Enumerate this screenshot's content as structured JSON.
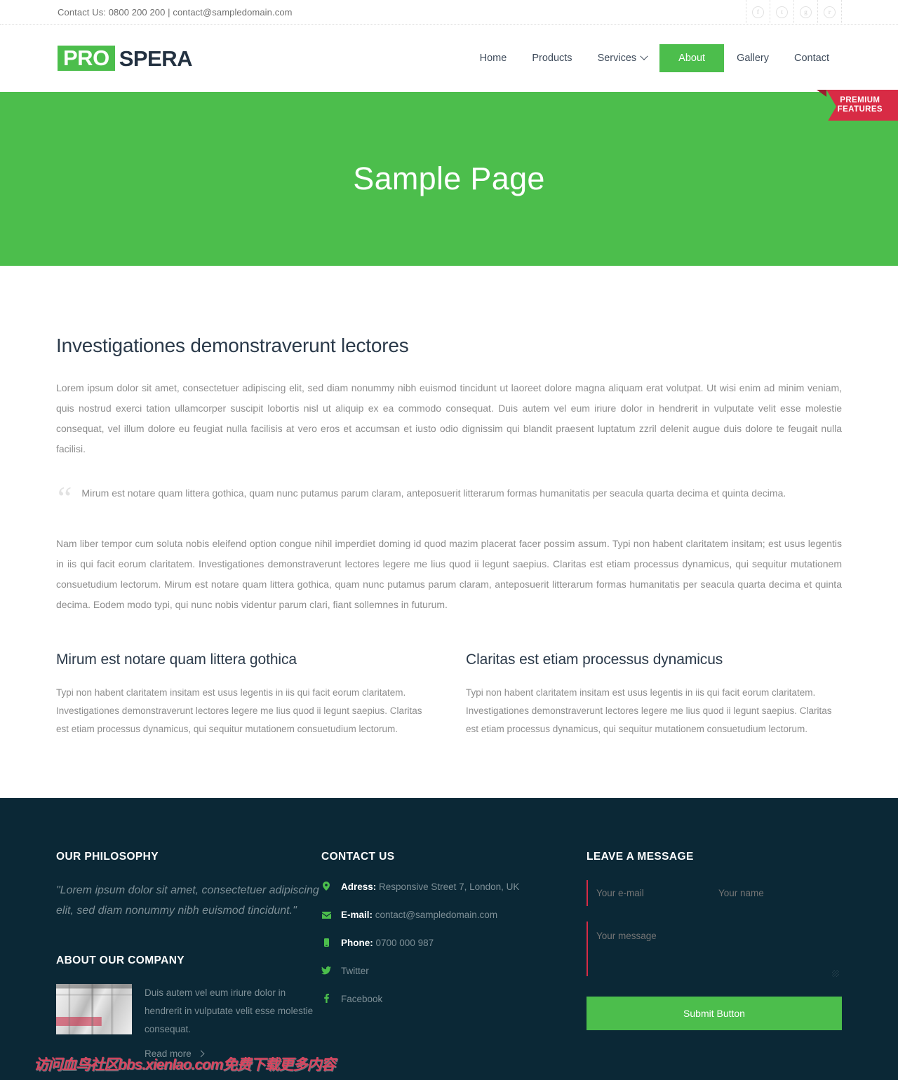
{
  "topbar": {
    "contact_text": "Contact Us: 0800 200 200 | contact@sampledomain.com",
    "social": [
      {
        "name": "facebook-icon",
        "glyph": "f"
      },
      {
        "name": "twitter-icon",
        "glyph": "t"
      },
      {
        "name": "google-plus-icon",
        "glyph": "g"
      },
      {
        "name": "rss-icon",
        "glyph": "r"
      }
    ]
  },
  "header": {
    "logo_pro": "PRO",
    "logo_spera": "SPERA",
    "nav": [
      {
        "label": "Home",
        "active": false,
        "dropdown": false
      },
      {
        "label": "Products",
        "active": false,
        "dropdown": false
      },
      {
        "label": "Services",
        "active": false,
        "dropdown": true
      },
      {
        "label": "About",
        "active": true,
        "dropdown": false
      },
      {
        "label": "Gallery",
        "active": false,
        "dropdown": false
      },
      {
        "label": "Contact",
        "active": false,
        "dropdown": false
      }
    ]
  },
  "hero": {
    "title": "Sample Page",
    "ribbon_line1": "PREMIUM",
    "ribbon_line2": "FEATURES"
  },
  "main": {
    "title": "Investigationes demonstraverunt lectores",
    "paragraph1": "Lorem ipsum dolor sit amet, consectetuer adipiscing elit, sed diam nonummy nibh euismod tincidunt ut laoreet dolore magna aliquam erat volutpat. Ut wisi enim ad minim veniam, quis nostrud exerci tation ullamcorper suscipit lobortis nisl ut aliquip ex ea commodo consequat. Duis autem vel eum iriure dolor in hendrerit in vulputate velit esse molestie consequat, vel illum dolore eu feugiat nulla facilisis at vero eros et accumsan et iusto odio dignissim qui blandit praesent luptatum zzril delenit augue duis dolore te feugait nulla facilisi.",
    "quote": "Mirum est notare quam littera gothica, quam nunc putamus parum claram, anteposuerit litterarum formas humanitatis per seacula quarta decima et quinta decima.",
    "paragraph2": "Nam liber tempor cum soluta nobis eleifend option congue nihil imperdiet doming id quod mazim placerat facer possim assum. Typi non habent claritatem insitam; est usus legentis in iis qui facit eorum claritatem. Investigationes demonstraverunt lectores legere me lius quod ii legunt saepius. Claritas est etiam processus dynamicus, qui sequitur mutationem consuetudium lectorum. Mirum est notare quam littera gothica, quam nunc putamus parum claram, anteposuerit litterarum formas humanitatis per seacula quarta decima et quinta decima. Eodem modo typi, qui nunc nobis videntur parum clari, fiant sollemnes in futurum.",
    "columns": [
      {
        "title": "Mirum est notare quam littera gothica",
        "text": "Typi non habent claritatem insitam est usus legentis in iis qui facit eorum claritatem. Investigationes demonstraverunt lectores legere me lius quod ii legunt saepius. Claritas est etiam processus dynamicus, qui sequitur mutationem consuetudium lectorum."
      },
      {
        "title": "Claritas est etiam processus dynamicus",
        "text": "Typi non habent claritatem insitam est usus legentis in iis qui facit eorum claritatem. Investigationes demonstraverunt lectores legere me lius quod ii legunt saepius. Claritas est etiam processus dynamicus, qui sequitur mutationem consuetudium lectorum."
      }
    ]
  },
  "footer": {
    "philosophy_heading": "OUR PHILOSOPHY",
    "philosophy_quote": "\"Lorem ipsum dolor sit amet, consectetuer adipiscing elit, sed diam nonummy nibh euismod tincidunt.\"",
    "about_heading": "ABOUT OUR COMPANY",
    "about_text": "Duis autem vel eum iriure dolor in hendrerit in vulputate velit esse molestie consequat.",
    "read_more": "Read more",
    "contact_heading": "CONTACT US",
    "contact_items": [
      {
        "icon": "map-pin-icon",
        "label": "Adress:",
        "value": "Responsive Street 7, London, UK"
      },
      {
        "icon": "envelope-icon",
        "label": "E-mail:",
        "value": "contact@sampledomain.com"
      },
      {
        "icon": "phone-icon",
        "label": "Phone:",
        "value": "0700 000 987"
      },
      {
        "icon": "twitter-icon",
        "label": "",
        "value": "Twitter"
      },
      {
        "icon": "facebook-icon",
        "label": "",
        "value": "Facebook"
      }
    ],
    "message_heading": "LEAVE A MESSAGE",
    "form": {
      "email_placeholder": "Your e-mail",
      "email_value": "",
      "name_placeholder": "Your name",
      "name_value": "",
      "message_placeholder": "Your message",
      "message_value": "",
      "submit_label": "Submit Button"
    },
    "watermark": "访问血鸟社区bbs.xienlao.com免费下载更多内容"
  },
  "colors": {
    "brand_green": "#4cbe4c",
    "ribbon_red": "#d82b45",
    "footer_bg": "#0b2836",
    "heading_navy": "#2b3a4a",
    "body_gray": "#8d8d8d"
  }
}
